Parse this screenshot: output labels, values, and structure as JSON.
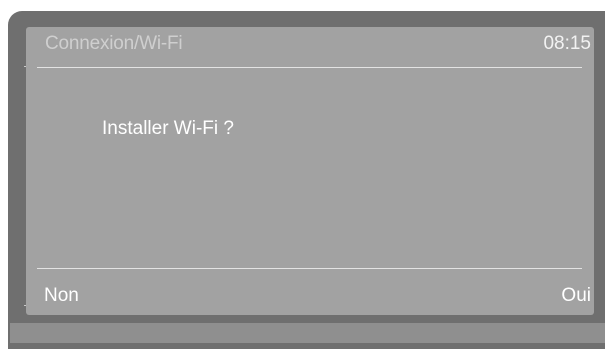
{
  "header": {
    "title": "Connexion/Wi-Fi",
    "time": "08:15"
  },
  "dialog": {
    "prompt": "Installer Wi-Fi ?"
  },
  "softkeys": {
    "left_label": "Non",
    "right_label": "Oui"
  },
  "colors": {
    "bezel": "#6f6f6f",
    "screen": "#a2a2a2",
    "text": "#ffffff"
  }
}
